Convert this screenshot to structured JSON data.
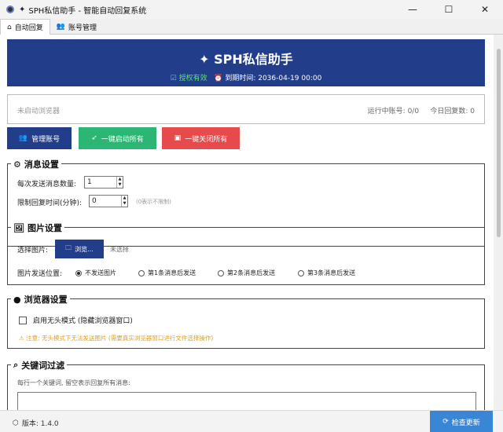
{
  "window": {
    "title": "SPH私信助手 - 智能自动回复系统",
    "minimize": "—",
    "maximize": "☐",
    "close": "✕"
  },
  "tabs": [
    {
      "label": "自动回复",
      "icon": "home-icon"
    },
    {
      "label": "账号管理",
      "icon": "users-icon"
    }
  ],
  "header": {
    "title": "SPH私信助手",
    "license": "授权有效",
    "expiry": "到期时间: 2036-04-19 00:00"
  },
  "status": {
    "browser": "未启动浏览器",
    "running": "运行中账号: 0/0",
    "today": "今日回复数: 0"
  },
  "actions": {
    "manage": "管理账号",
    "start_all": "一键启动所有",
    "close_all": "一键关闭所有"
  },
  "message_settings": {
    "title": "消息设置",
    "count_label": "每次发送消息数量:",
    "count_value": "1",
    "limit_label": "限制回复时间(分钟):",
    "limit_value": "0",
    "limit_hint": "(0表示不限制)"
  },
  "image_settings": {
    "title": "图片设置",
    "choose_label": "选择图片:",
    "browse": "浏览...",
    "selected": "未选择",
    "position_label": "图片发送位置:",
    "options": [
      "不发送图片",
      "第1条消息后发送",
      "第2条消息后发送",
      "第3条消息后发送"
    ],
    "selected_index": 0
  },
  "browser_settings": {
    "title": "浏览器设置",
    "headless": "启用无头模式 (隐藏浏览器窗口)",
    "headless_checked": false,
    "warning": "注意: 无头模式下无法发送图片 (需要真实浏览器窗口进行文件选择操作)"
  },
  "keyword_filter": {
    "title": "关键词过滤",
    "hint": "每行一个关键词, 留空表示回复所有消息:"
  },
  "footer": {
    "version": "版本: 1.4.0",
    "update": "检查更新"
  },
  "colors": {
    "header": "#223d8a",
    "manage": "#223d8a",
    "start": "#2bb673",
    "close": "#e64a4a",
    "update": "#3a86d6",
    "warning": "#e0a020"
  }
}
